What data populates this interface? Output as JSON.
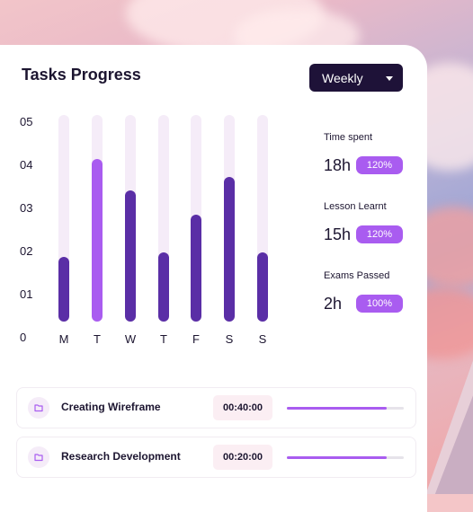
{
  "header": {
    "title": "Tasks Progress",
    "period_selector": "Weekly"
  },
  "chart_data": {
    "type": "bar",
    "categories": [
      "M",
      "T",
      "W",
      "T",
      "F",
      "S",
      "S"
    ],
    "y_ticks": [
      "05",
      "04",
      "03",
      "02",
      "01",
      "0"
    ],
    "ylim": [
      0,
      5
    ],
    "values": [
      1.45,
      3.65,
      2.95,
      1.55,
      2.4,
      3.25,
      1.55
    ],
    "highlighted_index": 1,
    "colors": {
      "track": "#f5ecf8",
      "bar": "#5a2ea6",
      "highlight": "#a95cf0"
    }
  },
  "stats": [
    {
      "label": "Time spent",
      "value": "18h",
      "badge": "120%"
    },
    {
      "label": "Lesson Learnt",
      "value": "15h",
      "badge": "120%"
    },
    {
      "label": "Exams Passed",
      "value": "2h",
      "badge": "100%"
    }
  ],
  "tasks": [
    {
      "name": "Creating Wireframe",
      "time": "00:40:00",
      "progress": 0.85
    },
    {
      "name": "Research Development",
      "time": "00:20:00",
      "progress": 0.85
    }
  ],
  "icons": {
    "task_icon": "folder-icon",
    "dropdown_icon": "chevron-down-icon"
  },
  "colors": {
    "accent": "#a95cf0",
    "dark": "#1e1238",
    "bar": "#5a2ea6"
  }
}
